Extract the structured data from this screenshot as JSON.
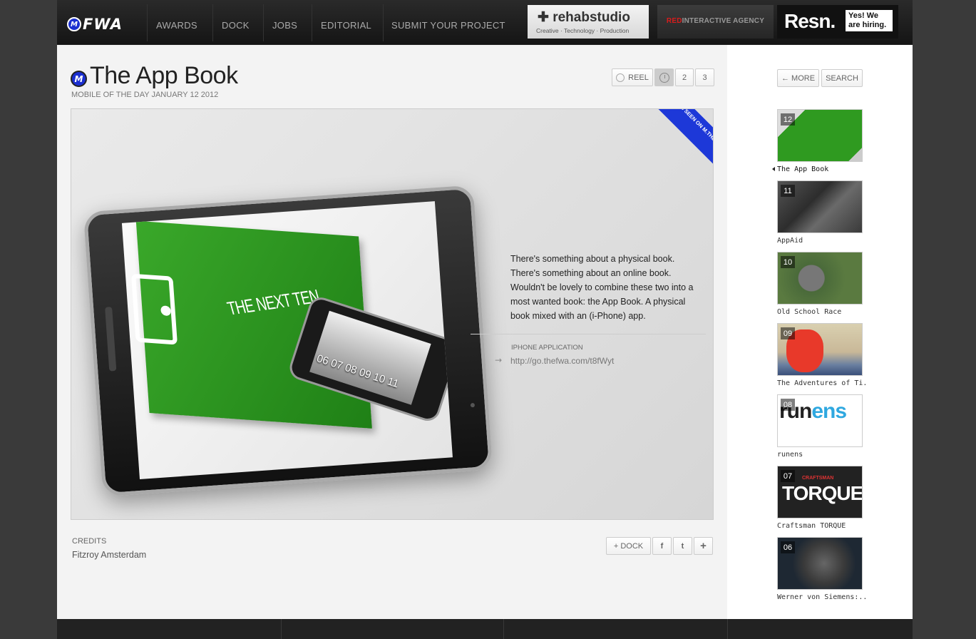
{
  "header": {
    "logo_m": "M",
    "logo_text": "FWA",
    "nav": [
      "AWARDS",
      "DOCK",
      "JOBS",
      "EDITORIAL",
      "SUBMIT YOUR PROJECT"
    ],
    "sponsors": {
      "rehab": {
        "name": "rehabstudio",
        "tagline": "Creative · Technology · Production"
      },
      "red": {
        "red_part": "RED",
        "rest": "INTERACTIVE AGENCY"
      },
      "resn": {
        "name": "Resn.",
        "hiring": "Yes! We are hiring."
      }
    }
  },
  "main": {
    "title_icon": "M",
    "title": "The App Book",
    "subtitle": "MOBILE OF THE DAY JANUARY 12 2012",
    "buttons": {
      "reel": "REEL",
      "page2": "2",
      "page3": "3"
    },
    "ribbon": "AS SEEN ON M.THEFWA.COM",
    "showcase_book_title": "THE NEXT TEN",
    "showcase_phone_numbers": "06 07 08 09 10 11",
    "description": "There's something about a physical book. There's something about an online book. Wouldn't be lovely to combine these two into a most wanted book: the App Book. A physical book mixed with an (i-Phone) app.",
    "app_label": "IPHONE APPLICATION",
    "app_link": "http://go.thefwa.com/t8fWyt",
    "credits_label": "CREDITS",
    "credits_name": "Fitzroy Amsterdam",
    "dock_label": "+ DOCK",
    "facebook_label": "f",
    "twitter_label": "t",
    "plus_label": "+"
  },
  "sidebar": {
    "more_label": "← MORE",
    "search_label": "SEARCH",
    "items": [
      {
        "num": "12",
        "label": "The App Book"
      },
      {
        "num": "11",
        "label": "AppAid"
      },
      {
        "num": "10",
        "label": "Old School Race"
      },
      {
        "num": "09",
        "label": "The Adventures of Ti..."
      },
      {
        "num": "08",
        "label": "runens"
      },
      {
        "num": "07",
        "label": "Craftsman TORQUE"
      },
      {
        "num": "06",
        "label": "Werner von Siemens:..."
      }
    ],
    "thumb_runens_a": "run",
    "thumb_runens_b": "ens",
    "thumb_torque_small": "CRAFTSMAN",
    "thumb_torque_big": "TORQUE"
  },
  "colors": {
    "accent_blue": "#1d38d8",
    "book_green": "#2f9a20"
  }
}
